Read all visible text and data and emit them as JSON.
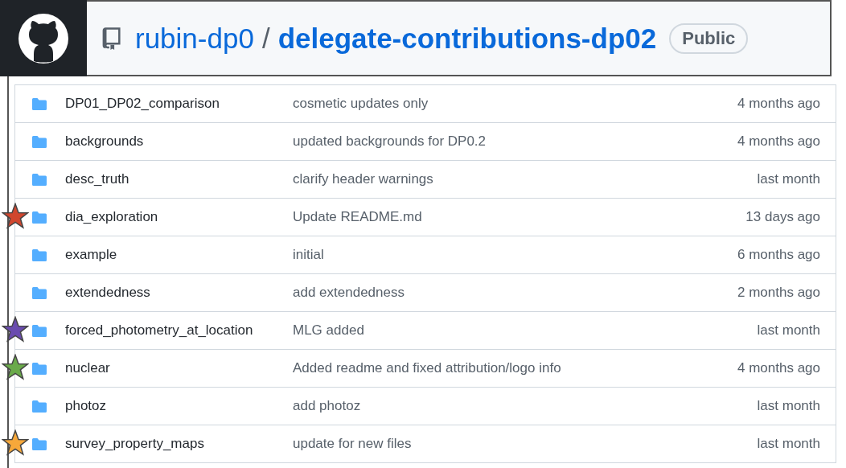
{
  "header": {
    "owner": "rubin-dp0",
    "separator": "/",
    "repo": "delegate-contributions-dp02",
    "visibility": "Public"
  },
  "rows": [
    {
      "name": "DP01_DP02_comparison",
      "message": "cosmetic updates only",
      "time": "4 months ago"
    },
    {
      "name": "backgrounds",
      "message": "updated backgrounds for DP0.2",
      "time": "4 months ago"
    },
    {
      "name": "desc_truth",
      "message": "clarify header warnings",
      "time": "last month"
    },
    {
      "name": "dia_exploration",
      "message": "Update README.md",
      "time": "13 days ago",
      "color": "#d0462e"
    },
    {
      "name": "example",
      "message": "initial",
      "time": "6 months ago"
    },
    {
      "name": "extendedness",
      "message": "add extendedness",
      "time": "2 months ago"
    },
    {
      "name": "forced_photometry_at_location",
      "message": "MLG added",
      "time": "last month",
      "color": "#6a4caf"
    },
    {
      "name": "nuclear",
      "message": "Added readme and fixed attribution/logo info",
      "time": "4 months ago",
      "color": "#6aaa4a"
    },
    {
      "name": "photoz",
      "message": "add photoz",
      "time": "last month"
    },
    {
      "name": "survey_property_maps",
      "message": "update for new files",
      "time": "last month",
      "color": "#f7a83a"
    }
  ]
}
